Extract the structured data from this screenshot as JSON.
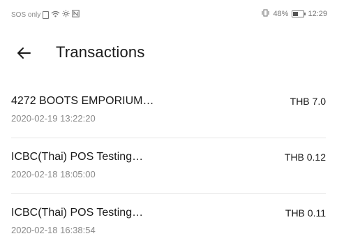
{
  "status_bar": {
    "network_text": "SOS only",
    "battery_percent": "48%",
    "battery_level": 0.48,
    "time": "12:29",
    "icons": [
      "sim-card-icon",
      "wifi-icon",
      "bluetooth-icon",
      "nfc-icon",
      "vibrate-icon",
      "battery-icon"
    ]
  },
  "header": {
    "title": "Transactions"
  },
  "transactions": [
    {
      "merchant": "4272 BOOTS EMPORIUM…",
      "datetime": "2020-02-19 13:22:20",
      "amount": "THB 7.0"
    },
    {
      "merchant": "ICBC(Thai) POS Testing…",
      "datetime": "2020-02-18 18:05:00",
      "amount": "THB 0.12"
    },
    {
      "merchant": "ICBC(Thai) POS Testing…",
      "datetime": "2020-02-18 16:38:54",
      "amount": "THB 0.11"
    }
  ]
}
